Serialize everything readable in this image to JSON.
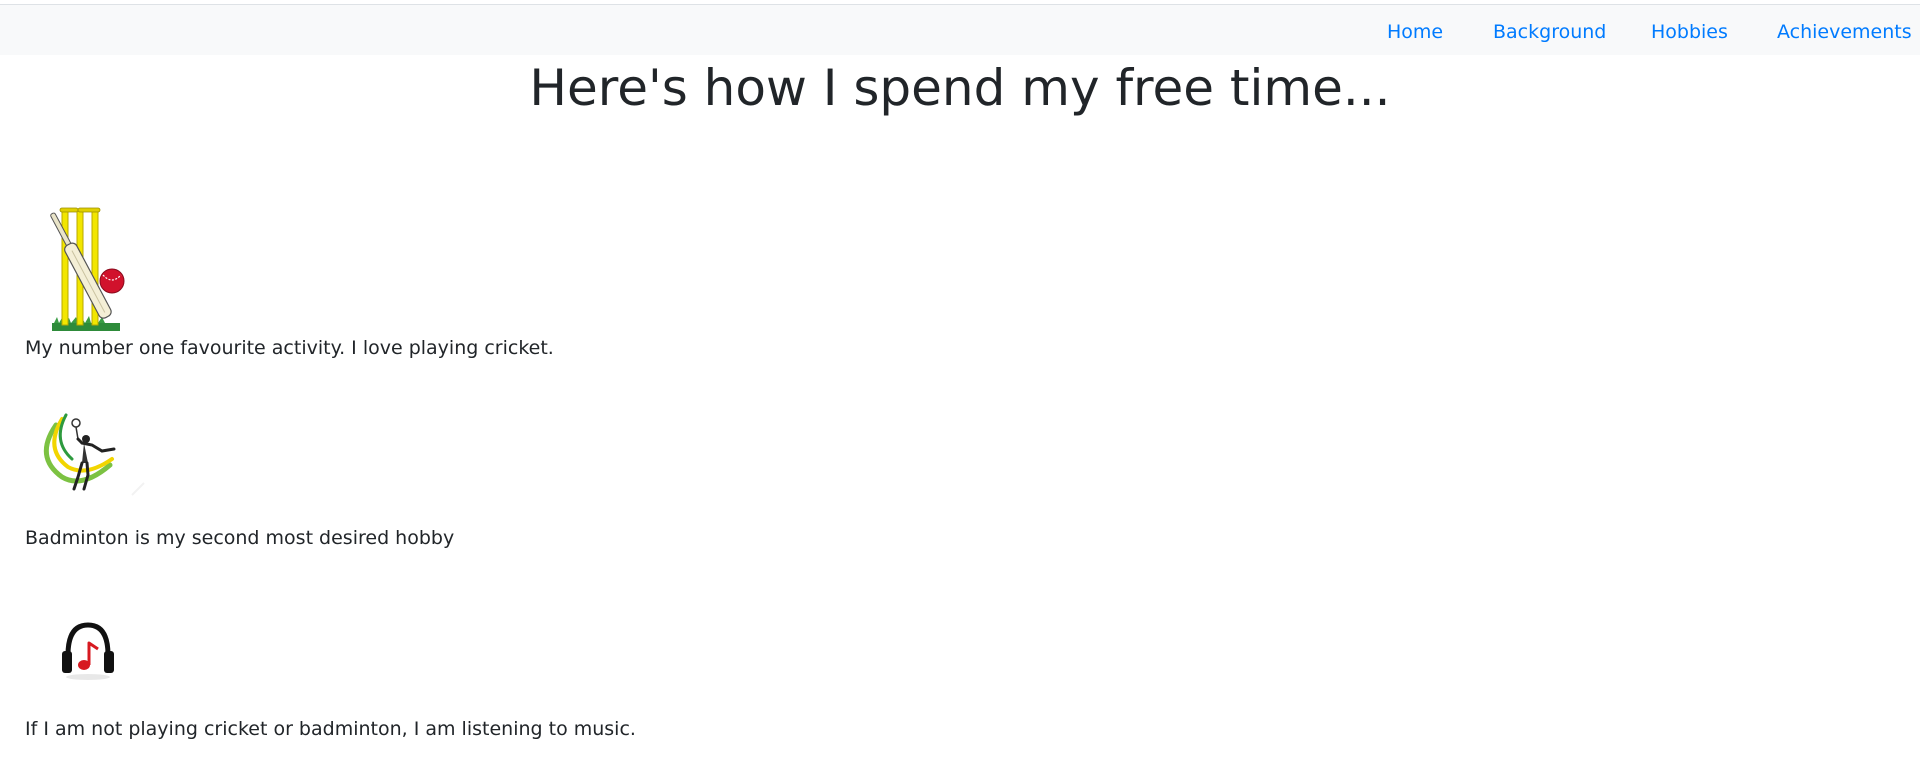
{
  "nav": {
    "items": [
      {
        "label": "Home",
        "color": "#007bff"
      },
      {
        "label": "Background",
        "color": "#007bff"
      },
      {
        "label": "Hobbies",
        "color": "#007bff"
      },
      {
        "label": "Achievements",
        "color": "#007bff"
      }
    ],
    "background": "#f8f9fa"
  },
  "main": {
    "title": "Here's how I spend my free time...",
    "hobbies": [
      {
        "icon": "cricket-icon",
        "text": "My number one favourite activity. I love playing cricket."
      },
      {
        "icon": "badminton-icon",
        "text": "Badminton is my second most desired hobby"
      },
      {
        "icon": "headphones-music-icon",
        "text": "If I am not playing cricket or badminton, I am listening to music."
      }
    ]
  },
  "colors": {
    "text": "#212529",
    "link": "#007bff"
  }
}
